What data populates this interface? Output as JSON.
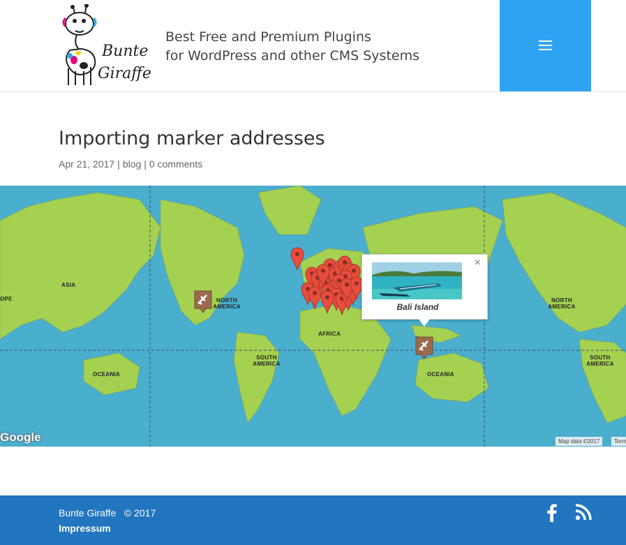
{
  "header": {
    "logo_text_line1": "Bunte",
    "logo_text_line2": "Giraffe",
    "tagline_line1": "Best Free and Premium Plugins",
    "tagline_line2": "for WordPress and other CMS Systems",
    "menu_icon": "hamburger-icon",
    "accent_color": "#2ea3f2"
  },
  "post": {
    "title": "Importing marker addresses",
    "date": "Apr 21, 2017",
    "separator": "|",
    "category": "blog",
    "comments": "0 comments"
  },
  "map": {
    "water_color": "#4aaecd",
    "land_color": "#a5d151",
    "labels": {
      "asia": "ASIA",
      "north_america_1": "NORTH AMERICA",
      "north_america_2": "NORTH AMERICA",
      "africa": "AFRICA",
      "south_america_1": "SOUTH AMERICA",
      "south_america_2": "SOUTH AMERICA",
      "oceania_1": "OCEANIA",
      "oceania_2": "OCEANIA",
      "europe_partial": "OPE"
    },
    "google_logo": "Google",
    "attribution": "Map data ©2017",
    "terms": "Terms",
    "marker_color": "#e84c3d",
    "airport_marker_color": "#9b6b4e",
    "infowindow": {
      "title": "Bali Island",
      "close_symbol": "×"
    }
  },
  "footer": {
    "copyright": "Bunte Giraffe   © 2017",
    "impressum": "Impressum",
    "facebook_icon": "facebook-icon",
    "rss_icon": "rss-icon",
    "background": "#2275bf"
  }
}
